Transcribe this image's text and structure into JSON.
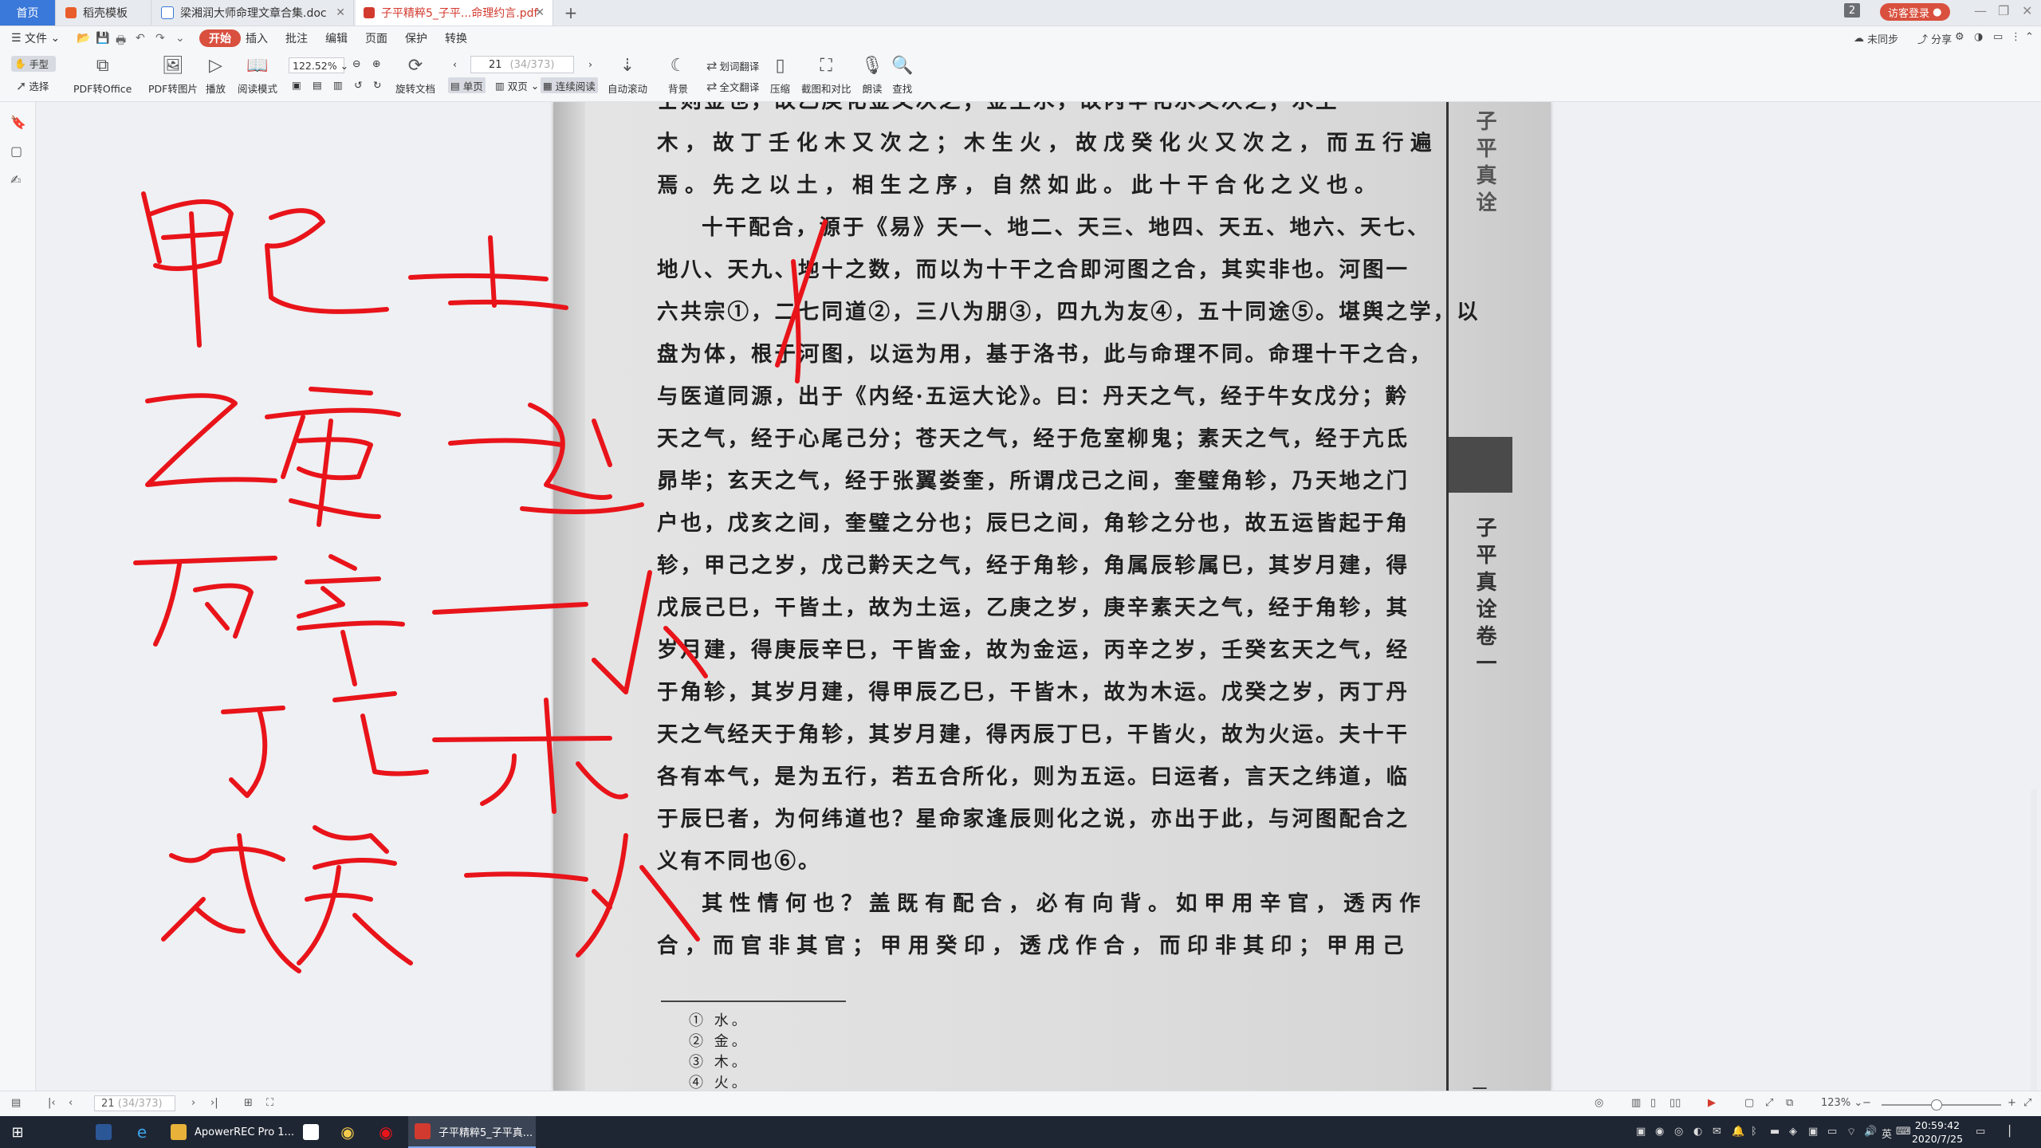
{
  "tabs": {
    "home": "首页",
    "tab1": "稻壳模板",
    "tab2": "梁湘润大师命理文章合集.doc",
    "tab3": "子平精粹5_子平...命理约言.pdf",
    "new_tab": "+"
  },
  "topbar": {
    "count": "2",
    "login": "访客登录"
  },
  "menu": {
    "file": "文件",
    "items": [
      "开始",
      "插入",
      "批注",
      "编辑",
      "页面",
      "保护",
      "转换"
    ],
    "sync": "未同步",
    "share": "分享"
  },
  "toolbar": {
    "hand": "手型",
    "select": "选择",
    "pdf_to_office": "PDF转Office",
    "pdf_to_image": "PDF转图片",
    "play": "播放",
    "read_mode": "阅读模式",
    "zoom": "122.52%",
    "rotate": "旋转文档",
    "single": "单页",
    "double": "双页",
    "continuous": "连续阅读",
    "page_current": "21",
    "page_total": "(34/373)",
    "auto_scroll": "自动滚动",
    "background": "背景",
    "word_translate": "划词翻译",
    "full_translate": "全文翻译",
    "compress": "压缩",
    "screenshot_compare": "截图和对比",
    "read_aloud": "朗读",
    "find": "查找"
  },
  "document": {
    "lines": [
      "壬则金也，故乙庚化金又次之；金生水，故丙辛化水又次之；水生",
      "木，故丁壬化木又次之；木生火，故戊癸化火又次之，而五行遍",
      "焉。先之以土，相生之序，自然如此。此十干合化之义也。",
      "十干配合，源于《易》天一、地二、天三、地四、天五、地六、天七、",
      "地八、天九、地十之数，而以为十干之合即河图之合，其实非也。河图一",
      "六共宗①，二七同道②，三八为朋③，四九为友④，五十同途⑤。堪舆之学，以",
      "盘为体，根于河图，以运为用，基于洛书，此与命理不同。命理十干之合，",
      "与医道同源，出于《内经·五运大论》。曰：丹天之气，经于牛女戊分；黅",
      "天之气，经于心尾己分；苍天之气，经于危室柳鬼；素天之气，经于亢氐",
      "昴毕；玄天之气，经于张翼娄奎，所谓戊己之间，奎璧角轸，乃天地之门",
      "户也，戊亥之间，奎璧之分也；辰巳之间，角轸之分也，故五运皆起于角",
      "轸，甲己之岁，戊己黅天之气，经于角轸，角属辰轸属巳，其岁月建，得",
      "戊辰己巳，干皆土，故为土运，乙庚之岁，庚辛素天之气，经于角轸，其",
      "岁月建，得庚辰辛巳，干皆金，故为金运，丙辛之岁，壬癸玄天之气，经",
      "于角轸，其岁月建，得甲辰乙巳，干皆木，故为木运。戊癸之岁，丙丁丹",
      "天之气经天于角轸，其岁月建，得丙辰丁巳，干皆火，故为火运。夫十干",
      "各有本气，是为五行，若五合所化，则为五运。曰运者，言天之纬道，临",
      "于辰巳者，为何纬道也？星命家逢辰则化之说，亦出于此，与河图配合之",
      "义有不同也⑥。",
      "其性情何也？盖既有配合，必有向背。如甲用辛官，透丙作",
      "合，而官非其官；甲用癸印，透戊作合，而印非其印；甲用己"
    ],
    "footnotes": [
      "① 水。",
      "② 金。",
      "③ 木。",
      "④ 火。"
    ],
    "side_title_top": "子平真诠",
    "side_title": "子平真诠卷一",
    "page_number": "二"
  },
  "handwriting": {
    "rows": [
      "甲己——土",
      "乙庚——金",
      "丙辛——水",
      "丁壬——木",
      "戊癸——火"
    ],
    "color": "#e8141a"
  },
  "statusbar": {
    "page": "21",
    "page_total": "(34/373)",
    "zoom": "123%"
  },
  "taskbar": {
    "apps": [
      "ApowerREC Pro 1...",
      "子平精粹5_子平真..."
    ],
    "time": "20:59:42",
    "date": "2020/7/25"
  }
}
